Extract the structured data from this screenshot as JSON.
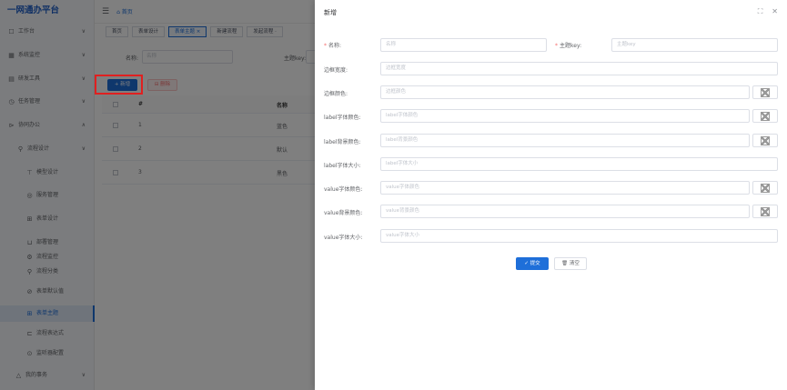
{
  "app": {
    "logo": "一网通办平台",
    "breadcrumb": "首页",
    "tabs": [
      {
        "label": "首页"
      },
      {
        "label": "表单设计"
      },
      {
        "label": "表单主题 ×"
      },
      {
        "label": "新建流程"
      },
      {
        "label": "发起流程 ·"
      }
    ],
    "menu": [
      {
        "icon": "☐",
        "label": "工作台",
        "chevron": "∨"
      },
      {
        "icon": "▦",
        "label": "系统监控",
        "chevron": "∨"
      },
      {
        "icon": "▤",
        "label": "研发工具",
        "chevron": "∨"
      },
      {
        "icon": "◷",
        "label": "任务管理",
        "chevron": "∨"
      },
      {
        "icon": "⊳",
        "label": "协同办公",
        "chevron": "∧"
      },
      {
        "icon": "⚲",
        "label": "流程设计",
        "chevron": "∨"
      },
      {
        "icon": "⊤",
        "label": "模型设计",
        "chevron": ""
      },
      {
        "icon": "◎",
        "label": "服务管理",
        "chevron": ""
      },
      {
        "icon": "⊞",
        "label": "表单设计",
        "chevron": ""
      },
      {
        "icon": "⊔",
        "label": "部署管理",
        "chevron": ""
      },
      {
        "icon": "⚙",
        "label": "流程监控",
        "chevron": ""
      },
      {
        "icon": "⚲",
        "label": "流程分类",
        "chevron": ""
      },
      {
        "icon": "⊘",
        "label": "表单默认值",
        "chevron": ""
      },
      {
        "icon": "⊞",
        "label": "表单主题",
        "chevron": ""
      },
      {
        "icon": "⊏",
        "label": "流程表达式",
        "chevron": ""
      },
      {
        "icon": "⊙",
        "label": "监听器配置",
        "chevron": ""
      },
      {
        "icon": "△",
        "label": "我的事务",
        "chevron": "∨"
      }
    ],
    "search": {
      "name_label": "名称:",
      "name_placeholder": "名称",
      "key_label": "主题key:"
    },
    "toolbar": {
      "add_label": "+ 新增",
      "delete_label": "⊟ 删除"
    },
    "table": {
      "headers": {
        "index": "#",
        "name": "名称"
      },
      "rows": [
        {
          "index": "1",
          "name": "蓝色"
        },
        {
          "index": "2",
          "name": "默认"
        },
        {
          "index": "3",
          "name": "黑色"
        }
      ]
    }
  },
  "drawer": {
    "title": "新增",
    "fullscreen_icon": "⛶",
    "close_icon": "✕",
    "fields": {
      "name": {
        "label": "名称:",
        "placeholder": "名称",
        "required": "*"
      },
      "key": {
        "label": "主题key:",
        "placeholder": "主题key",
        "required": "*"
      },
      "border_width": {
        "label": "边框宽度:",
        "placeholder": "边框宽度"
      },
      "border_color": {
        "label": "边框颜色:",
        "placeholder": "边框颜色"
      },
      "label_font_color": {
        "label": "label字体颜色:",
        "placeholder": "label字体颜色"
      },
      "label_bg_color": {
        "label": "label背景颜色:",
        "placeholder": "label背景颜色"
      },
      "label_font_size": {
        "label": "label字体大小:",
        "placeholder": "label字体大小"
      },
      "value_font_color": {
        "label": "value字体颜色:",
        "placeholder": "value字体颜色"
      },
      "value_bg_color": {
        "label": "value背景颜色:",
        "placeholder": "value背景颜色"
      },
      "value_font_size": {
        "label": "value字体大小:",
        "placeholder": "value字体大小"
      }
    },
    "submit_label": "✓ 提交",
    "clear_label": "🗑 清空"
  },
  "colors": {
    "primary": "#1e6fd9",
    "logo": "#1e5fc8",
    "danger": "#f56c6c",
    "highlight": "#e02020"
  }
}
